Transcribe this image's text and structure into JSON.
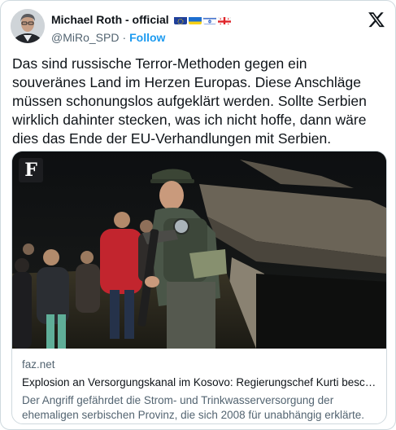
{
  "author": {
    "display_name": "Michael Roth - official",
    "handle": "@MiRo_SPD",
    "separator": "·",
    "follow_label": "Follow",
    "flags": [
      "eu-flag",
      "ukraine-flag",
      "israel-flag",
      "georgia-flag"
    ]
  },
  "tweet": {
    "text": "Das sind russische Terror-Methoden gegen ein souveränes Land im Herzen Europas. Diese Anschläge müssen schonungslos aufgeklärt werden. Sollte Serbien wirklich dahinter stecken, was ich nicht hoffe, dann wäre dies das Ende der EU-Verhandlungen mit Serbien."
  },
  "link_card": {
    "badge": "F",
    "domain": "faz.net",
    "headline": "Explosion an Versorgungskanal im Kosovo: Regierungschef Kurti beschuldigt Serbien",
    "description": "Der Angriff gefährdet die Strom- und Trinkwasserversorgung der ehemaligen serbischen Provinz, die sich 2008 für unabhängig erklärte. Die Regierung in Pristina macht Serbien verantwortlich."
  },
  "colors": {
    "link_blue": "#1d9bf0",
    "secondary_text": "#536471",
    "border": "#cfd9de"
  },
  "icons": {
    "platform_logo": "x-logo-icon"
  }
}
